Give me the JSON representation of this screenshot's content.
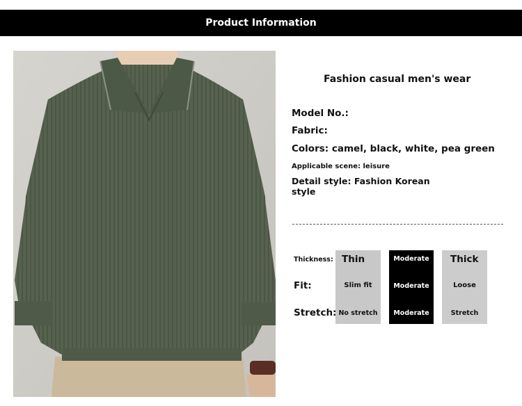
{
  "header": {
    "title": "Product Information"
  },
  "product": {
    "subtitle": "Fashion casual men's wear",
    "model": "Model No.:",
    "fabric": "Fabric:",
    "colors": "Colors: camel, black, white, pea green",
    "scene": "Applicable scene: leisure",
    "detail_line1": "Detail style: Fashion Korean",
    "detail_line2": "style"
  },
  "image": {
    "icon": "green-polo-shirt-photo",
    "shirt_color": "#56624f"
  },
  "attributes": {
    "rows": [
      "Thickness:",
      "Fit:",
      "Stretch:"
    ],
    "columns": [
      {
        "cells": [
          "Thin",
          "Slim fit",
          "No stretch"
        ],
        "bg": "#c8c8c8"
      },
      {
        "cells": [
          "Moderate",
          "Moderate",
          "Moderate"
        ],
        "bg": "#000000"
      },
      {
        "cells": [
          "Thick",
          "Loose",
          "Stretch"
        ],
        "bg": "#cccccc"
      }
    ]
  }
}
